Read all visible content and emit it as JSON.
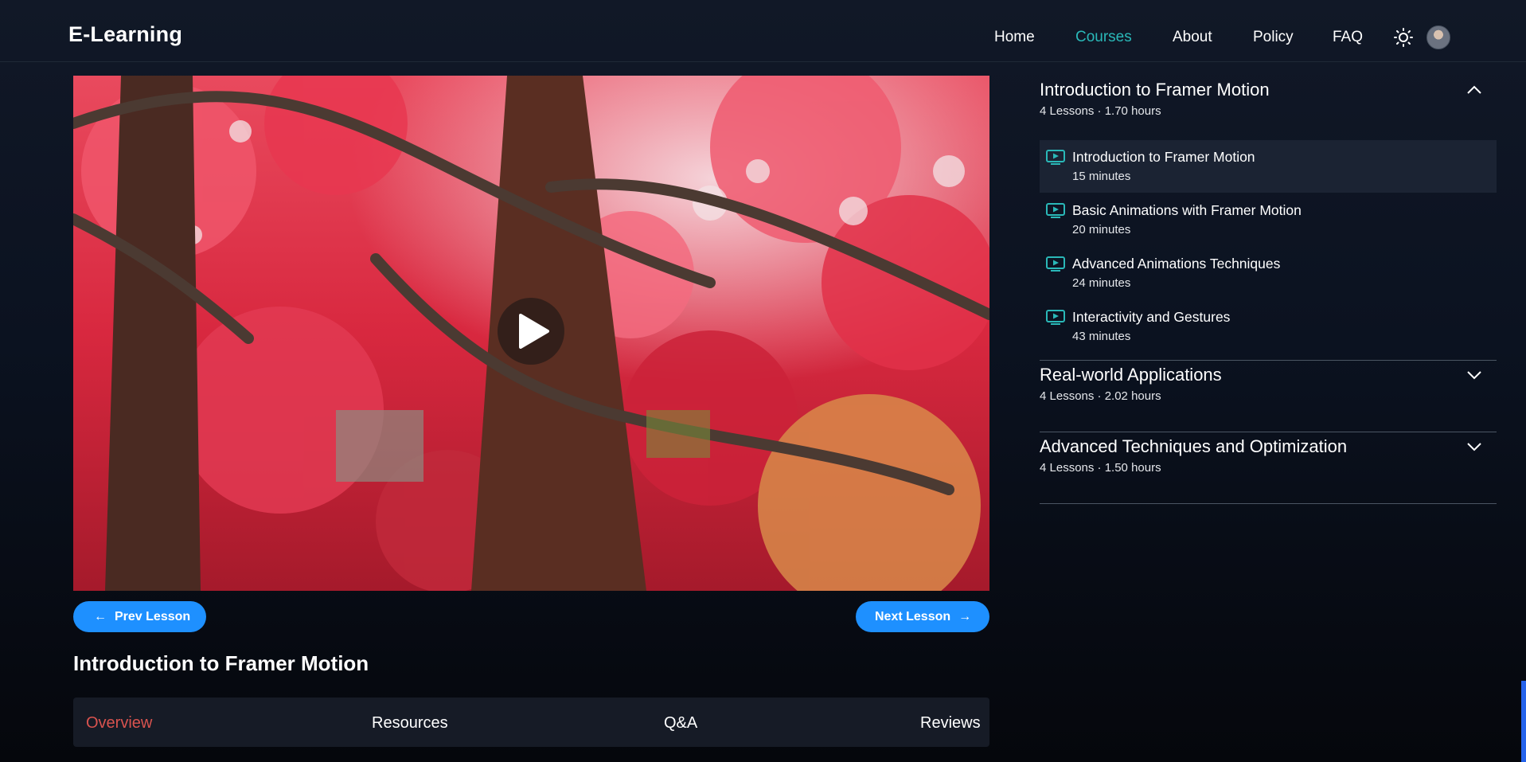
{
  "header": {
    "logo": "E-Learning",
    "nav": [
      "Home",
      "Courses",
      "About",
      "Policy",
      "FAQ"
    ],
    "active_nav": "Courses"
  },
  "video": {
    "thumbnail": "autumn maple tree with red leaves",
    "play_icon": "play-icon"
  },
  "controls": {
    "prev_label": "Prev Lesson",
    "next_label": "Next Lesson"
  },
  "lesson": {
    "title": "Introduction to Framer Motion"
  },
  "tabs": [
    "Overview",
    "Resources",
    "Q&A",
    "Reviews"
  ],
  "active_tab": "Overview",
  "sidebar": {
    "sections": [
      {
        "title": "Introduction to Framer Motion",
        "meta": "4 Lessons · 1.70 hours",
        "expanded": true,
        "lessons": [
          {
            "title": "Introduction to Framer Motion",
            "duration": "15 minutes",
            "selected": true
          },
          {
            "title": "Basic Animations with Framer Motion",
            "duration": "20 minutes"
          },
          {
            "title": "Advanced Animations Techniques",
            "duration": "24 minutes"
          },
          {
            "title": "Interactivity and Gestures",
            "duration": "43 minutes"
          }
        ]
      },
      {
        "title": "Real-world Applications",
        "meta": "4 Lessons · 2.02 hours",
        "expanded": false
      },
      {
        "title": "Advanced Techniques and Optimization",
        "meta": "4 Lessons · 1.50 hours",
        "expanded": false
      }
    ]
  },
  "colors": {
    "accent_button": "#1e90ff",
    "active_nav": "#2ab8b8",
    "active_tab": "#d9534f",
    "lesson_icon": "#2ab8b8"
  }
}
